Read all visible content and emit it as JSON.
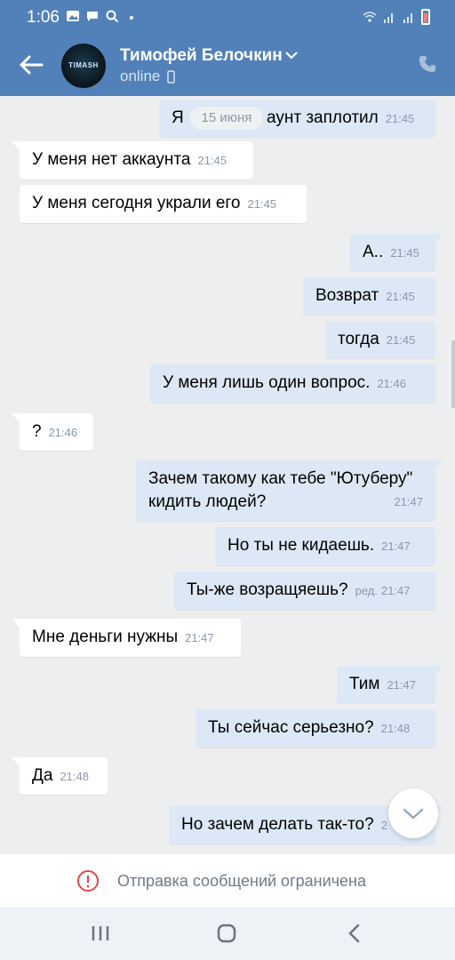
{
  "status_bar": {
    "time": "1:06"
  },
  "header": {
    "contact_name": "Тимофей Белочкин",
    "presence": "online",
    "avatar_text": "TIMASH",
    "colors": {
      "header_bg": "#5181b8",
      "bubble_out": "#dde8f7",
      "bubble_in": "#ffffff"
    }
  },
  "date_separator": "15 июня",
  "messages": [
    {
      "dir": "out",
      "text": "Я уже аккаунт заплотил",
      "visible_text_left": "Я ",
      "visible_text_right": "аунт заплотил",
      "time": "21:45"
    },
    {
      "dir": "in",
      "text": "У меня нет аккаунта",
      "time": "21:45"
    },
    {
      "dir": "in",
      "text": "У меня сегодня украли его",
      "time": "21:45"
    },
    {
      "dir": "out",
      "text": "А..",
      "time": "21:45"
    },
    {
      "dir": "out",
      "text": "Возврат",
      "time": "21:45"
    },
    {
      "dir": "out",
      "text": "тогда",
      "time": "21:45"
    },
    {
      "dir": "out",
      "text": "У меня лишь один вопрос.",
      "time": "21:46"
    },
    {
      "dir": "in",
      "text": "?",
      "time": "21:46"
    },
    {
      "dir": "out",
      "text": "Зачем такому как тебе \"Ютуберу\" кидить людей?",
      "line1": "Зачем такому как тебе \"Ютуберу\"",
      "line2": "кидить людей?",
      "time": "21:47"
    },
    {
      "dir": "out",
      "text": "Но ты не кидаешь.",
      "time": "21:47"
    },
    {
      "dir": "out",
      "text": "Ты-же возращяешь?",
      "edited": "ред.",
      "time": "21:47"
    },
    {
      "dir": "in",
      "text": "Мне деньги нужны",
      "time": "21:47"
    },
    {
      "dir": "out",
      "text": "Тим",
      "time": "21:47"
    },
    {
      "dir": "out",
      "text": "Ты сейчас серьезно?",
      "time": "21:48"
    },
    {
      "dir": "in",
      "text": "Да",
      "time": "21:48"
    },
    {
      "dir": "out",
      "text": "Но зачем делать так-то?",
      "time": "21:48",
      "time_visible": "2"
    }
  ],
  "restriction_notice": "Отправка сообщений ограничена",
  "icons": {
    "back": "back-arrow-icon",
    "chevron": "chevron-down-icon",
    "phone": "phone-icon",
    "scroll_down": "scroll-down-icon",
    "warning": "warning-circle-icon",
    "nav_recent": "recent-apps-icon",
    "nav_home": "home-icon",
    "nav_back": "nav-back-icon"
  }
}
